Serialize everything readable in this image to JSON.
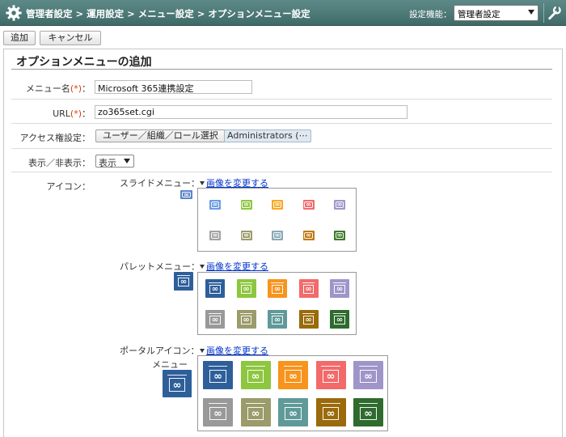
{
  "header": {
    "breadcrumb": "管理者設定 > 運用設定 > メニュー設定 > オプションメニュー設定",
    "function_label": "設定機能：",
    "function_value": "管理者設定",
    "icons": [
      "gear-icon",
      "wrench-icon"
    ]
  },
  "toolbar": {
    "add_label": "追加",
    "cancel_label": "キャンセル"
  },
  "form": {
    "title": "オプションメニューの追加",
    "menu_name": {
      "label": "メニュー名",
      "required_mark": "(*)",
      "colon": "：",
      "value": "Microsoft 365連携設定"
    },
    "url": {
      "label": "URL",
      "required_mark": "(*)",
      "colon": "：",
      "value": "zo365set.cgi"
    },
    "access": {
      "label": "アクセス権設定：",
      "select_button": "ユーザー／組織／ロール選択",
      "chip": "Administrators (⋯"
    },
    "visibility": {
      "label": "表示／非表示：",
      "value": "表示"
    },
    "icon": {
      "label": "アイコン：",
      "change_link": "画像を変更する",
      "slide": {
        "label": "スライドメニュー："
      },
      "palette": {
        "label": "パレットメニュー："
      },
      "portal": {
        "label": "ポータルアイコン：",
        "sublabel": "メニュー"
      }
    }
  },
  "colors": {
    "header": "#4a7674",
    "selected_small": "#5b86c9",
    "selected_medium": "#2e5f9a",
    "icon_palette": [
      "#2e5f9a",
      "#8dc63f",
      "#f7941d",
      "#f26a6a",
      "#9f95c9",
      "#999999",
      "#9b9b6b",
      "#5f9a99",
      "#9a6a0b",
      "#2f6b2f"
    ],
    "small_palette": [
      "#6a9be0",
      "#8dc63f",
      "#f7a823",
      "#f26a6a",
      "#9f95c9",
      "#a3a3a3",
      "#9b9b6b",
      "#8aa9b5",
      "#c07a0f",
      "#3e7b2b"
    ]
  }
}
